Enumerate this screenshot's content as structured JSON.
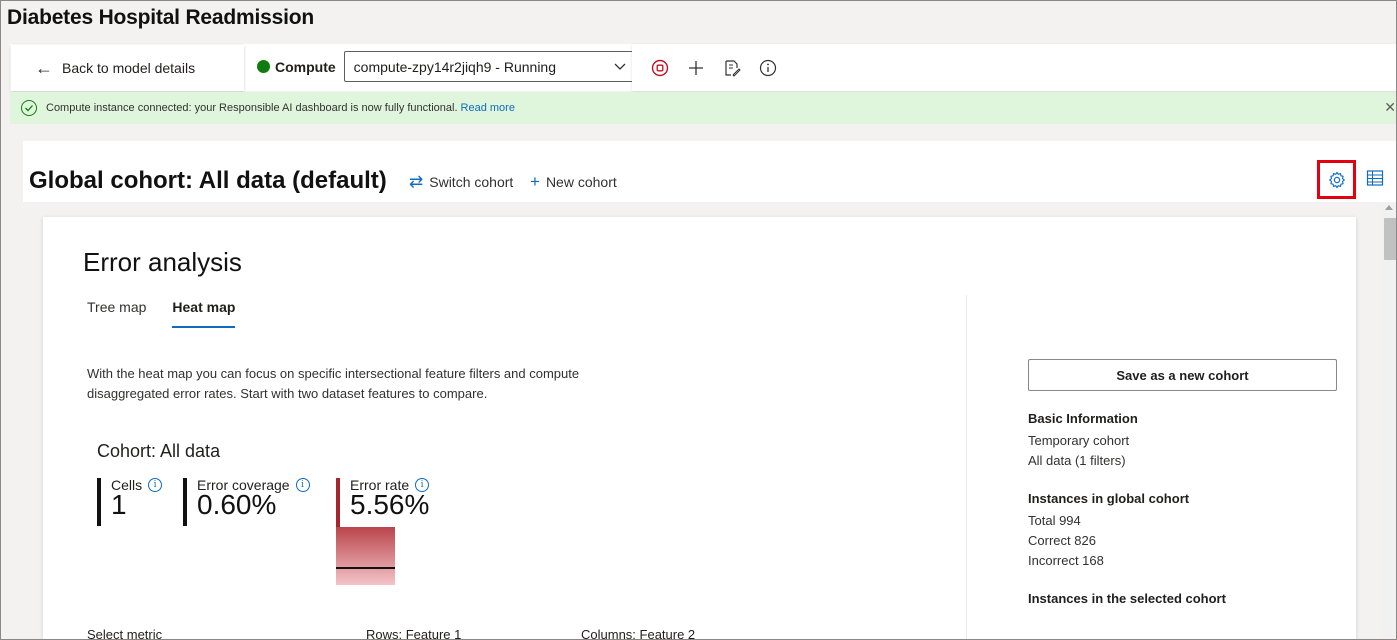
{
  "app": {
    "title": "Diabetes Hospital Readmission"
  },
  "toolbar": {
    "back_label": "Back to model details",
    "compute_label": "Compute",
    "compute_value": "compute-zpy14r2jiqh9 - Running",
    "status_color": "#107c10"
  },
  "banner": {
    "text": "Compute instance connected: your Responsible AI dashboard is now fully functional.",
    "link": "Read more"
  },
  "cohort": {
    "title": "Global cohort: All data (default)",
    "switch_label": "Switch cohort",
    "new_label": "New cohort"
  },
  "error_analysis": {
    "title": "Error analysis",
    "tabs": [
      "Tree map",
      "Heat map"
    ],
    "active_tab": "Heat map",
    "description": "With the heat map you can focus on specific intersectional feature filters and compute disaggregated error rates. Start with two dataset features to compare.",
    "cohort_label": "Cohort: All data",
    "metrics": {
      "cells_label": "Cells",
      "cells_value": "1",
      "coverage_label": "Error coverage",
      "coverage_value": "0.60%",
      "rate_label": "Error rate",
      "rate_value": "5.56%",
      "rate_color": "#a4262c"
    },
    "bottom": {
      "select_metric": "Select metric",
      "rows": "Rows: Feature 1",
      "columns": "Columns: Feature 2"
    }
  },
  "side_panel": {
    "save_label": "Save as a new cohort",
    "basic_info": {
      "heading": "Basic Information",
      "lines": [
        "Temporary cohort",
        "All data (1 filters)"
      ]
    },
    "global": {
      "heading": "Instances in global cohort",
      "lines": [
        "Total 994",
        "Correct 826",
        "Incorrect 168"
      ]
    },
    "selected": {
      "heading": "Instances in the selected cohort"
    }
  },
  "icons": {
    "back": "arrow-left-icon",
    "stop": "stop-circle-icon",
    "add": "plus-icon",
    "edit": "document-edit-icon",
    "info": "info-icon",
    "success": "check-circle-icon",
    "close": "close-icon",
    "switch": "switch-arrows-icon",
    "new": "plus-icon",
    "settings": "gear-icon",
    "table": "table-icon"
  },
  "colors": {
    "accent": "#0f6cbd",
    "highlight": "#e3000f",
    "banner_bg": "#dff6dd"
  }
}
